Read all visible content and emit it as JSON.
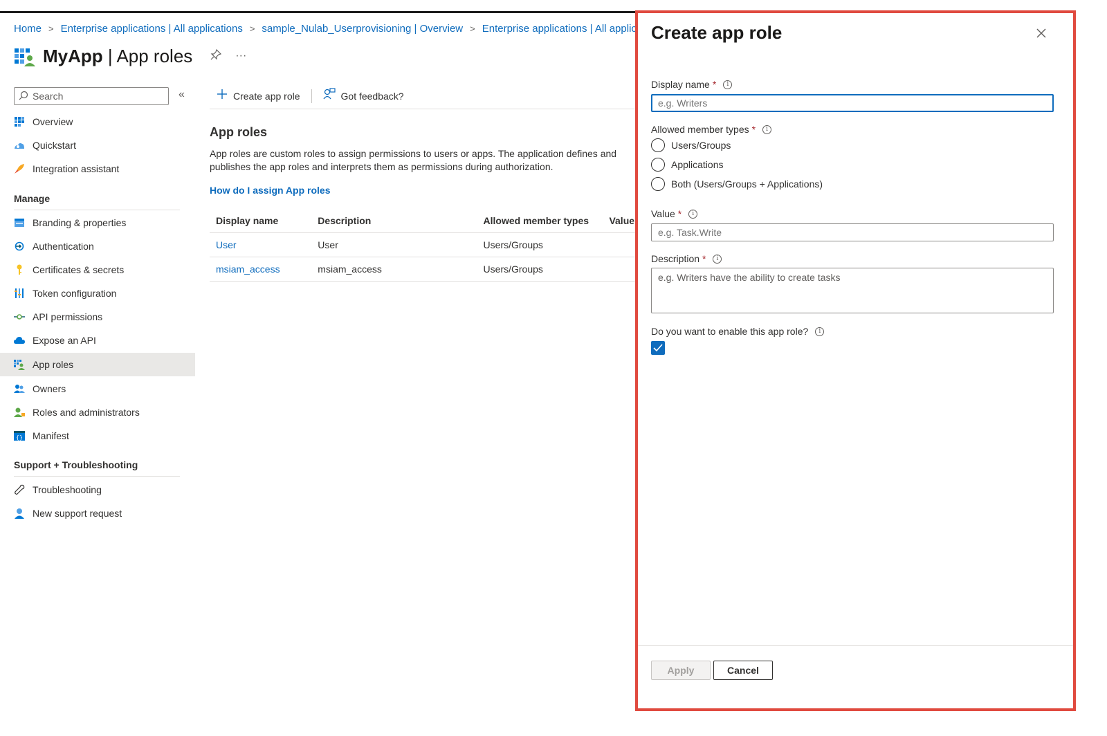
{
  "breadcrumb": {
    "items": [
      "Home",
      "Enterprise applications | All applications",
      "sample_Nulab_Userprovisioning | Overview",
      "Enterprise applications | All applications"
    ],
    "separator": ">"
  },
  "header": {
    "app_name": "MyApp",
    "title_suffix": " | App roles",
    "more_label": "···"
  },
  "sidebar": {
    "search_placeholder": "Search",
    "collapse_label": "«",
    "top_items": [
      {
        "label": "Overview",
        "icon": "overview-icon"
      },
      {
        "label": "Quickstart",
        "icon": "quickstart-icon"
      },
      {
        "label": "Integration assistant",
        "icon": "rocket-icon"
      }
    ],
    "manage_heading": "Manage",
    "manage_items": [
      {
        "label": "Branding & properties",
        "icon": "branding-icon"
      },
      {
        "label": "Authentication",
        "icon": "authentication-icon"
      },
      {
        "label": "Certificates & secrets",
        "icon": "key-icon"
      },
      {
        "label": "Token configuration",
        "icon": "token-icon"
      },
      {
        "label": "API permissions",
        "icon": "api-permissions-icon"
      },
      {
        "label": "Expose an API",
        "icon": "cloud-icon"
      },
      {
        "label": "App roles",
        "icon": "app-roles-icon",
        "selected": true
      },
      {
        "label": "Owners",
        "icon": "owners-icon"
      },
      {
        "label": "Roles and administrators",
        "icon": "roles-admin-icon"
      },
      {
        "label": "Manifest",
        "icon": "manifest-icon"
      }
    ],
    "support_heading": "Support + Troubleshooting",
    "support_items": [
      {
        "label": "Troubleshooting",
        "icon": "wrench-icon"
      },
      {
        "label": "New support request",
        "icon": "support-person-icon"
      }
    ]
  },
  "toolbar": {
    "create_label": "Create app role",
    "feedback_label": "Got feedback?"
  },
  "main": {
    "section_title": "App roles",
    "description": "App roles are custom roles to assign permissions to users or apps. The application defines and publishes the app roles and interprets them as permissions during authorization.",
    "help_link": "How do I assign App roles",
    "table": {
      "headers": [
        "Display name",
        "Description",
        "Allowed member types",
        "Value"
      ],
      "rows": [
        [
          "User",
          "User",
          "Users/Groups",
          ""
        ],
        [
          "msiam_access",
          "msiam_access",
          "Users/Groups",
          ""
        ]
      ]
    }
  },
  "panel": {
    "title": "Create app role",
    "display_name": {
      "label": "Display name",
      "placeholder": "e.g. Writers",
      "value": ""
    },
    "member_types": {
      "label": "Allowed member types",
      "options": [
        "Users/Groups",
        "Applications",
        "Both (Users/Groups + Applications)"
      ],
      "selected": null
    },
    "value": {
      "label": "Value",
      "placeholder": "e.g. Task.Write",
      "value": ""
    },
    "description": {
      "label": "Description",
      "placeholder": "e.g. Writers have the ability to create tasks",
      "value": ""
    },
    "enable": {
      "label": "Do you want to enable this app role?",
      "checked": true
    },
    "required_mark": "*",
    "info_mark": "i",
    "apply_label": "Apply",
    "apply_enabled": false,
    "cancel_label": "Cancel"
  },
  "colors": {
    "accent": "#0f6cbd",
    "highlight_border": "#e04a3f",
    "selected_nav": "#e9e8e6",
    "required": "#a4262c"
  }
}
